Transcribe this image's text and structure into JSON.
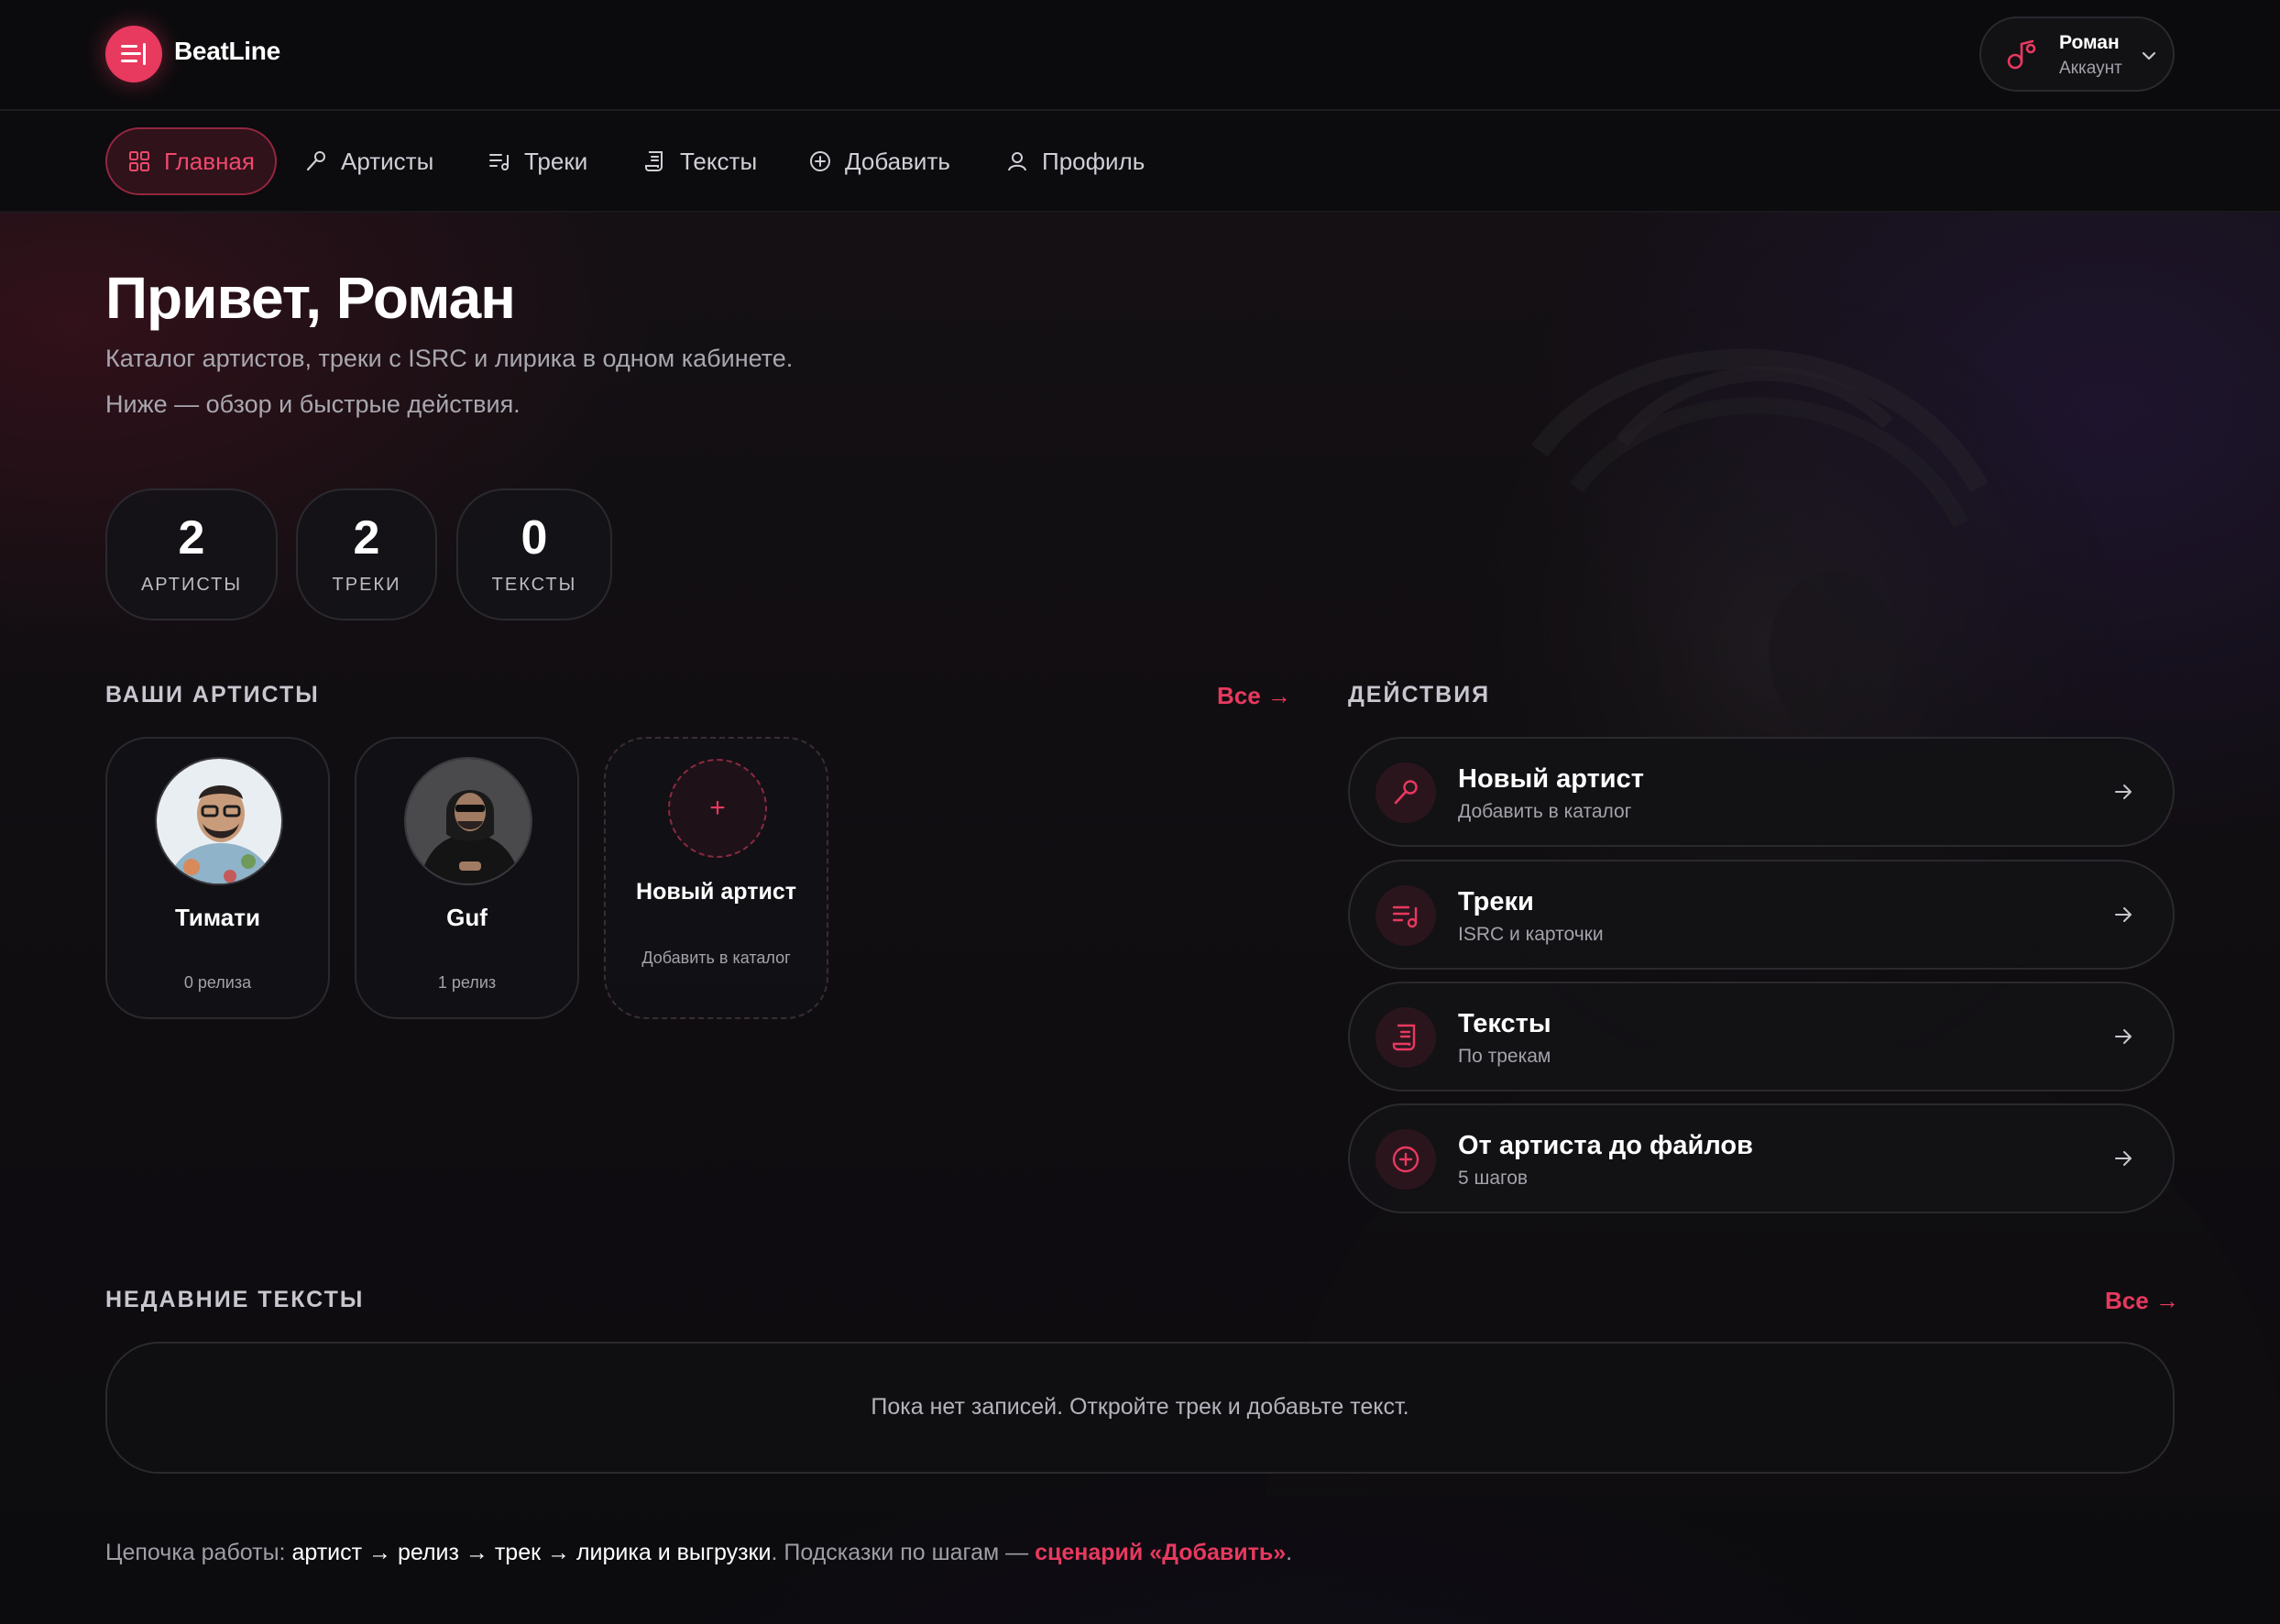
{
  "brand": {
    "name": "BeatLine",
    "accent": "#e8395f"
  },
  "account": {
    "name": "Роман",
    "subtitle": "Аккаунт"
  },
  "nav": [
    {
      "label": "Главная",
      "icon": "grid-icon",
      "active": true
    },
    {
      "label": "Артисты",
      "icon": "microphone-icon",
      "active": false
    },
    {
      "label": "Треки",
      "icon": "playlist-icon",
      "active": false
    },
    {
      "label": "Тексты",
      "icon": "scroll-icon",
      "active": false
    },
    {
      "label": "Добавить",
      "icon": "plus-circle-icon",
      "active": false
    },
    {
      "label": "Профиль",
      "icon": "user-icon",
      "active": false
    }
  ],
  "hero": {
    "title": "Привет, Роман",
    "line1": "Каталог артистов, треки с ISRC и лирика в одном кабинете.",
    "line2": "Ниже — обзор и быстрые действия."
  },
  "stats": [
    {
      "value": "2",
      "label": "АРТИСТЫ"
    },
    {
      "value": "2",
      "label": "ТРЕКИ"
    },
    {
      "value": "0",
      "label": "ТЕКСТЫ"
    }
  ],
  "artists_section": {
    "title": "ВАШИ АРТИСТЫ",
    "all_link": "Все →",
    "artists": [
      {
        "name": "Тимати",
        "releases": "0 релиза"
      },
      {
        "name": "Guf",
        "releases": "1 релиз"
      }
    ],
    "new_card": {
      "plus": "+",
      "title": "Новый артист",
      "subtitle": "Добавить в каталог"
    }
  },
  "actions_section": {
    "title": "ДЕЙСТВИЯ",
    "items": [
      {
        "title": "Новый артист",
        "subtitle": "Добавить в каталог",
        "icon": "microphone-icon"
      },
      {
        "title": "Треки",
        "subtitle": "ISRC и карточки",
        "icon": "playlist-icon"
      },
      {
        "title": "Тексты",
        "subtitle": "По трекам",
        "icon": "scroll-icon"
      },
      {
        "title": "От артиста до файлов",
        "subtitle": "5 шагов",
        "icon": "plus-circle-icon"
      }
    ]
  },
  "recent_texts": {
    "title": "НЕДАВНИЕ ТЕКСТЫ",
    "all_link": "Все →",
    "empty": "Пока нет записей. Откройте трек и добавьте текст."
  },
  "footer": {
    "prefix": "Цепочка работы: ",
    "chain": "артист → релиз → трек → лирика и выгрузки",
    "middle": ". Подсказки по шагам — ",
    "link": "сценарий «Добавить»",
    "suffix": "."
  }
}
